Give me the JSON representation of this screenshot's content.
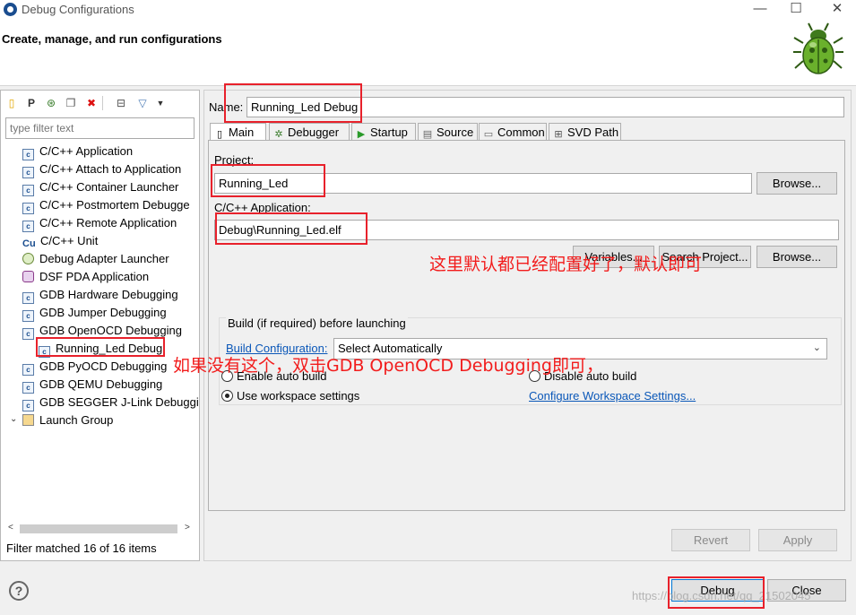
{
  "window": {
    "title": "Debug Configurations",
    "subtitle": "Create, manage, and run configurations",
    "minimize_icon": "minimize-icon",
    "maximize_icon": "maximize-icon",
    "close_icon": "close-icon",
    "minimize_glyph": "—",
    "maximize_glyph": "☐",
    "close_glyph": "✕"
  },
  "left": {
    "filter_placeholder": "type filter text",
    "tree": [
      {
        "label": "C/C++ Application",
        "icon": "c-icon"
      },
      {
        "label": "C/C++ Attach to Application",
        "icon": "c-icon"
      },
      {
        "label": "C/C++ Container Launcher",
        "icon": "c-icon"
      },
      {
        "label": "C/C++ Postmortem Debugge",
        "icon": "c-icon"
      },
      {
        "label": "C/C++ Remote Application",
        "icon": "c-icon"
      },
      {
        "label": "C/C++ Unit",
        "icon": "cu-icon"
      },
      {
        "label": "Debug Adapter Launcher",
        "icon": "bug-icon"
      },
      {
        "label": "DSF PDA Application",
        "icon": "pda-icon"
      },
      {
        "label": "GDB Hardware Debugging",
        "icon": "c-icon"
      },
      {
        "label": "GDB Jumper Debugging",
        "icon": "c-icon"
      },
      {
        "label": "GDB OpenOCD Debugging",
        "icon": "c-icon"
      },
      {
        "label": "Running_Led Debug",
        "icon": "c-icon"
      },
      {
        "label": "GDB PyOCD Debugging",
        "icon": "c-icon"
      },
      {
        "label": "GDB QEMU Debugging",
        "icon": "c-icon"
      },
      {
        "label": "GDB SEGGER J-Link Debuggi",
        "icon": "c-icon"
      },
      {
        "label": "Launch Group",
        "icon": "launch-group-icon"
      }
    ],
    "status": "Filter matched 16 of 16 items"
  },
  "config": {
    "name_label": "Name:",
    "name_value": "Running_Led Debug",
    "tabs": [
      {
        "label": "Main",
        "icon": "main-tab-icon",
        "glyph": "▯"
      },
      {
        "label": "Debugger",
        "icon": "debugger-tab-icon",
        "glyph": "✲"
      },
      {
        "label": "Startup",
        "icon": "startup-tab-icon",
        "glyph": "▶"
      },
      {
        "label": "Source",
        "icon": "source-tab-icon",
        "glyph": "▤"
      },
      {
        "label": "Common",
        "icon": "common-tab-icon",
        "glyph": "▭"
      },
      {
        "label": "SVD Path",
        "icon": "svd-path-tab-icon",
        "glyph": "⊞"
      }
    ],
    "project_label": "Project:",
    "project_value": "Running_Led",
    "browse_label": "Browse...",
    "app_label": "C/C++ Application:",
    "app_value": "Debug\\Running_Led.elf",
    "variables_label": "Variables...",
    "search_project_label": "Search Project...",
    "build_group_title": "Build (if required) before launching",
    "build_config_link": "Build Configuration:",
    "build_config_value": "Select Automatically",
    "enable_auto_build": "Enable auto build",
    "disable_auto_build": "Disable auto build",
    "use_workspace_settings": "Use workspace settings",
    "configure_workspace_link": "Configure Workspace Settings...",
    "revert_label": "Revert",
    "apply_label": "Apply"
  },
  "footer": {
    "debug_label": "Debug",
    "close_label": "Close"
  },
  "annotations": {
    "note_defaults": "这里默认都已经配置好了，默认即可",
    "note_double_click": "如果没有这个，双击GDB OpenOCD Debugging即可，"
  },
  "watermark": "https://blog.csdn.net/qq_21502045",
  "colors": {
    "annotation_red": "#e8212b",
    "link_blue": "#0a57b8"
  }
}
